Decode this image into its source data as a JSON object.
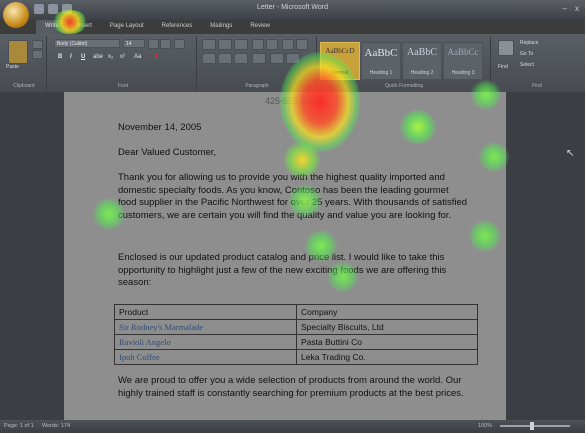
{
  "window": {
    "title": "Letter - Microsoft Word",
    "minimize_glyph": "–",
    "close_glyph": "x"
  },
  "tabs": [
    "Write",
    "Insert",
    "Page Layout",
    "References",
    "Mailings",
    "Review"
  ],
  "ribbon": {
    "font_name": "Body (Calibri)",
    "font_size": "14",
    "font_buttons": [
      "B",
      "I",
      "U",
      "abe",
      "x₂",
      "x²",
      "Aa",
      "A"
    ],
    "group_labels": [
      "Clipboard",
      "Font",
      "Paragraph",
      "Quick Formatting",
      "Find"
    ],
    "paste_label": "Paste",
    "styles": [
      {
        "sample": "AaBbCcD",
        "name": "Normal",
        "selected": true
      },
      {
        "sample": "AaBbC",
        "name": "Heading 1"
      },
      {
        "sample": "AaBbC",
        "name": "Heading 2"
      },
      {
        "sample": "AaBbCc",
        "name": "Heading 3"
      }
    ],
    "find": {
      "label": "Find",
      "replace": "Replace",
      "goto": "Go To",
      "select": "Select"
    }
  },
  "document": {
    "phone": "425-555-0100",
    "date": "November 14, 2005",
    "salutation": "Dear Valued Customer,",
    "para1": "Thank you for allowing us to provide you with the highest quality imported and domestic specialty foods. As you know, Contoso has been the leading gourmet food supplier in the Pacific Northwest for over 25 years. With thousands of satisfied customers, we are certain you will find the quality and value you are looking for.",
    "para2": "Enclosed is our updated product catalog and price list. I would like to take this opportunity to highlight just a few of the new exciting foods we are offering this season:",
    "table_headers": [
      "Product",
      "Company"
    ],
    "table_rows": [
      [
        "Sir Rodney's Marmalade",
        "Specialty Biscuits, Ltd"
      ],
      [
        "Ravioli Angelo",
        "Pasta Buttini Co"
      ],
      [
        "Ipoh Coffee",
        "Leka Trading Co."
      ]
    ],
    "para3": "We are proud to offer you a wide selection of products from around the world. Our highly trained staff is constantly searching for premium products at the best prices."
  },
  "statusbar": {
    "page": "Page: 1 of 1",
    "words": "Words: 174",
    "zoom": "100%"
  },
  "colors": {
    "accent": "#c98b1a",
    "heat_hot": "#ff2a2a",
    "heat_warm": "#f2f21a",
    "heat_cool": "#4cf04c"
  }
}
